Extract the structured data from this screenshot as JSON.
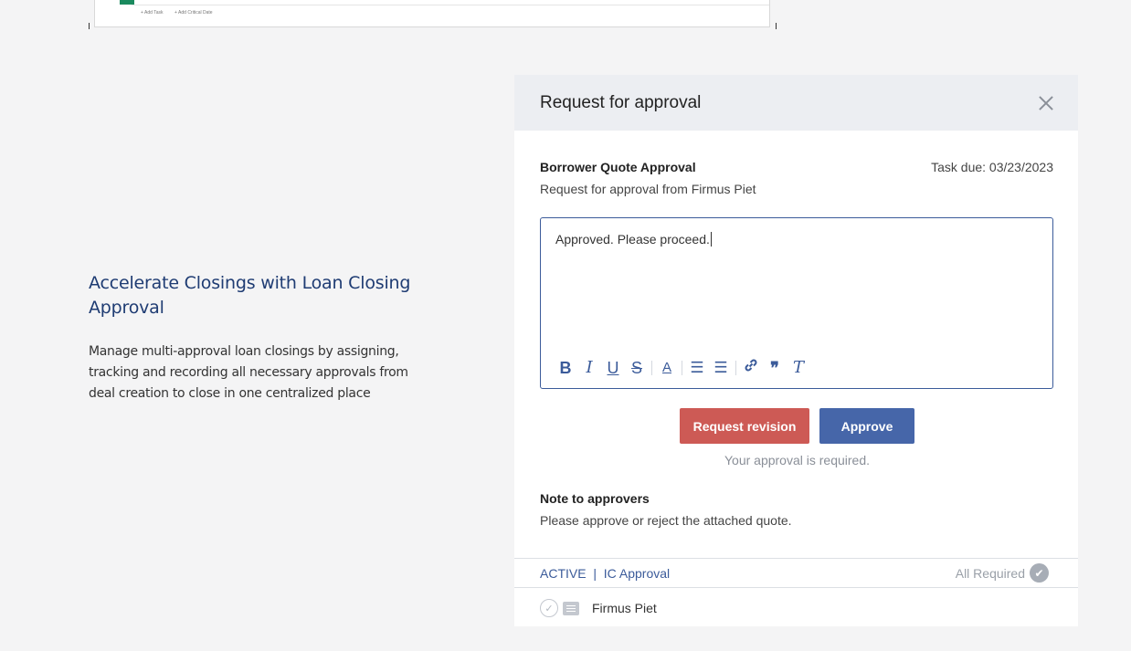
{
  "top_shot": {
    "add_task": "+ Add Task",
    "add_critical_date": "+ Add Critical Date"
  },
  "promo": {
    "heading": "Accelerate Closings with Loan Closing Approval",
    "body": "Manage multi-approval loan closings by assigning, tracking and recording all necessary approvals from deal creation to close in one centralized place"
  },
  "modal": {
    "title": "Request for approval",
    "task_title": "Borrower Quote Approval",
    "task_due": "Task due: 03/23/2023",
    "task_subtitle": "Request for approval from Firmus Piet",
    "editor_value": "Approved. Please proceed.",
    "toolbar": {
      "bold": "B",
      "italic": "I",
      "underline": "U",
      "strike": "S",
      "color": "A",
      "ordered_list": "☰",
      "bullet_list": "☰",
      "link": "🔗",
      "quote": "❞",
      "clear": "T"
    },
    "request_revision_label": "Request revision",
    "approve_label": "Approve",
    "required_text": "Your approval is required.",
    "note_title": "Note to approvers",
    "note_body": "Please approve or reject the attached quote.",
    "status_left": "ACTIVE  |  IC Approval",
    "status_right": "All Required",
    "approver_name": "Firmus Piet"
  }
}
